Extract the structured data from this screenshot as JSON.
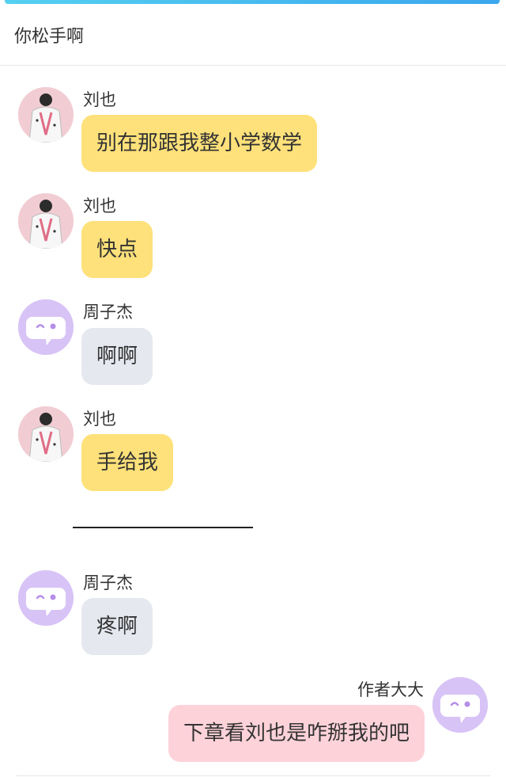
{
  "previous_text": "你松手啊",
  "messages": [
    {
      "sender": "刘也",
      "text": "别在那跟我整小学数学",
      "avatar": "photo-avatar",
      "bubble": "yellow"
    },
    {
      "sender": "刘也",
      "text": "快点",
      "avatar": "photo-avatar",
      "bubble": "yellow"
    },
    {
      "sender": "周子杰",
      "text": "啊啊",
      "avatar": "bot-face-icon",
      "bubble": "gray"
    },
    {
      "sender": "刘也",
      "text": "手给我",
      "avatar": "photo-avatar",
      "bubble": "yellow"
    },
    {
      "sender": "周子杰",
      "text": "疼啊",
      "avatar": "bot-face-icon",
      "bubble": "gray"
    },
    {
      "sender": "作者大大",
      "text": "下章看刘也是咋掰我的吧",
      "avatar": "bot-face-icon",
      "bubble": "pink"
    }
  ],
  "colors": {
    "yellow_bubble": "#fee17a",
    "gray_bubble": "#e5e8ef",
    "pink_bubble": "#fdd2d9",
    "bot_avatar": "#d8c3f6",
    "top_bar": "#3aa7ee"
  }
}
